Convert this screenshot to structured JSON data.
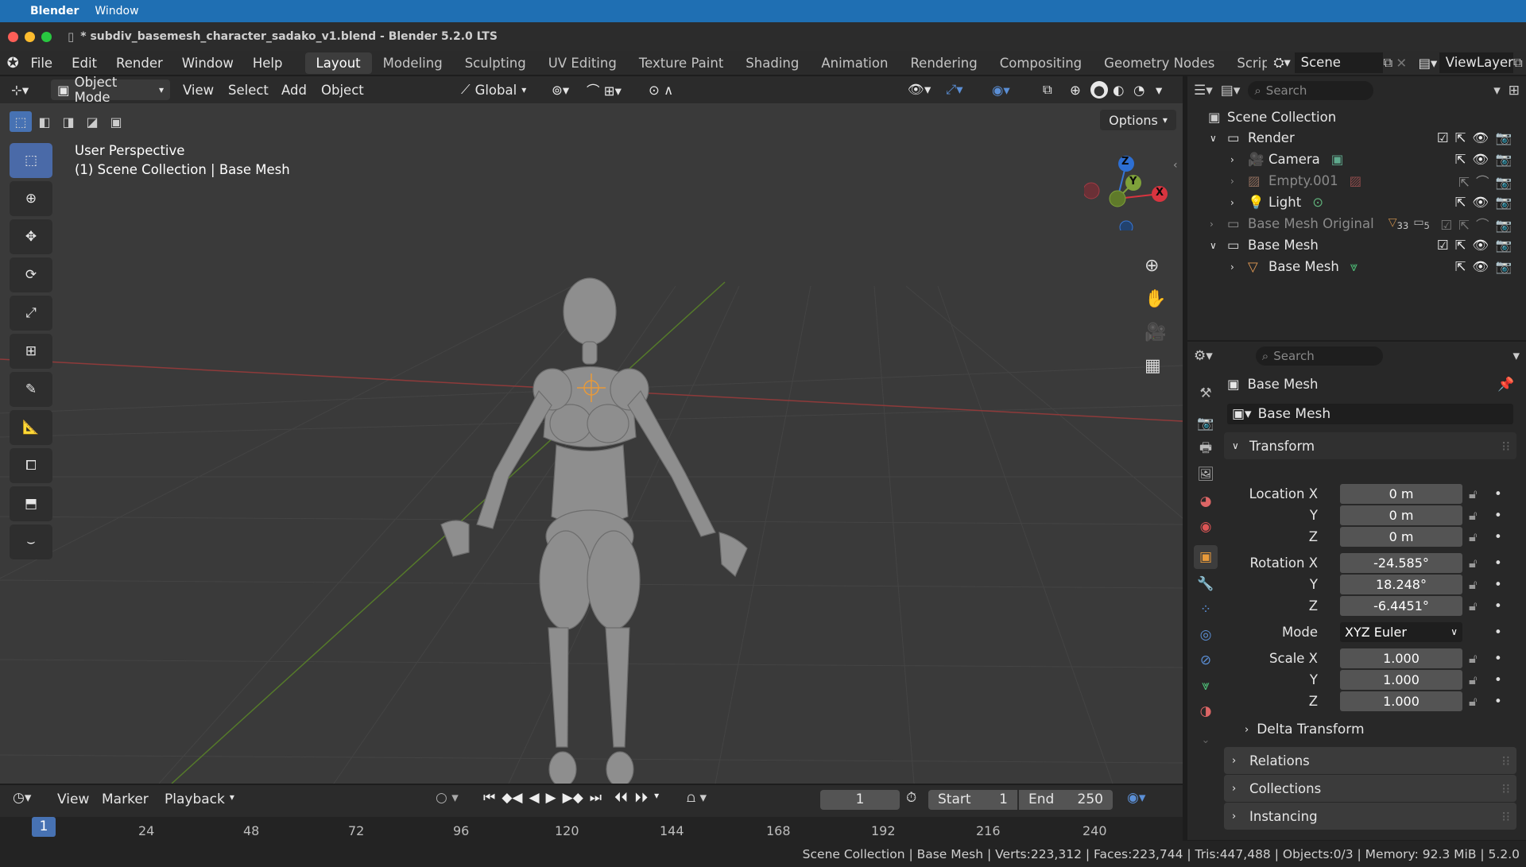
{
  "os_menu": {
    "app": "Blender",
    "window": "Window"
  },
  "window_title": "* subdiv_basemesh_character_sadako_v1.blend - Blender 5.2.0 LTS",
  "menu": [
    "File",
    "Edit",
    "Render",
    "Window",
    "Help"
  ],
  "workspaces": [
    "Layout",
    "Modeling",
    "Sculpting",
    "UV Editing",
    "Texture Paint",
    "Shading",
    "Animation",
    "Rendering",
    "Compositing",
    "Geometry Nodes",
    "Scriptin"
  ],
  "scene": "Scene",
  "view_layer": "ViewLayer",
  "viewport_header": {
    "mode": "Object Mode",
    "menus": [
      "View",
      "Select",
      "Add",
      "Object"
    ],
    "orientation": "Global",
    "options": "Options"
  },
  "viewport_overlay": {
    "line1": "User Perspective",
    "line2": "(1) Scene Collection | Base Mesh"
  },
  "gizmo": {
    "x": "X",
    "y": "Y",
    "z": "Z"
  },
  "outliner": {
    "search_placeholder": "Search",
    "root": "Scene Collection",
    "rows": [
      {
        "name": "Render",
        "type": "collection"
      },
      {
        "name": "Camera",
        "type": "camera"
      },
      {
        "name": "Empty.001",
        "type": "empty"
      },
      {
        "name": "Light",
        "type": "light"
      },
      {
        "name": "Base Mesh Original",
        "type": "collection"
      },
      {
        "name": "Base Mesh",
        "type": "collection"
      },
      {
        "name": "Base Mesh",
        "type": "mesh"
      }
    ],
    "modifier_count_a": "33",
    "modifier_count_b": "5"
  },
  "properties": {
    "search_placeholder": "Search",
    "object_name": "Base Mesh",
    "data_name": "Base Mesh",
    "transform_label": "Transform",
    "location": {
      "label": "Location X",
      "x": "0 m",
      "y": "0 m",
      "z": "0 m"
    },
    "rotation": {
      "label": "Rotation X",
      "x": "-24.585°",
      "y": "18.248°",
      "z": "-6.4451°"
    },
    "mode": {
      "label": "Mode",
      "value": "XYZ Euler"
    },
    "scale": {
      "label": "Scale X",
      "x": "1.000",
      "y": "1.000",
      "z": "1.000"
    },
    "axis_y": "Y",
    "axis_z": "Z",
    "panels": [
      "Delta Transform",
      "Relations",
      "Collections",
      "Instancing"
    ]
  },
  "timeline": {
    "menus": [
      "View",
      "Marker",
      "Playback"
    ],
    "current_frame": "1",
    "start_label": "Start",
    "start": "1",
    "end_label": "End",
    "end": "250",
    "ruler": [
      "1",
      "24",
      "48",
      "72",
      "96",
      "120",
      "144",
      "168",
      "192",
      "216",
      "240"
    ]
  },
  "status": "Scene Collection | Base Mesh | Verts:223,312 | Faces:223,744 | Tris:447,488 | Objects:0/3 | Memory: 92.3 MiB | 5.2.0",
  "colors": {
    "accent": "#4772b3",
    "x_axis": "#d8343f",
    "y_axis": "#6b9a23",
    "z_axis": "#2d6fd3"
  }
}
